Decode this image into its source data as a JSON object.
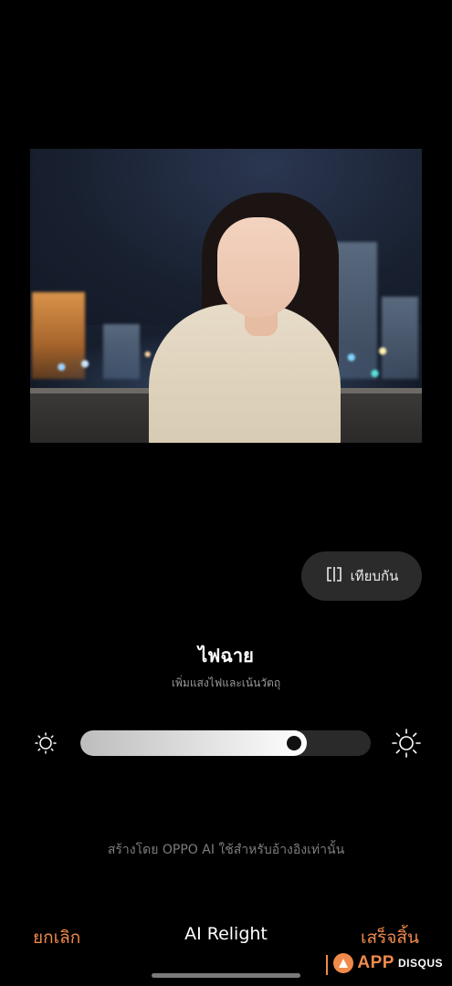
{
  "compare": {
    "label": "เทียบกัน",
    "icon": "compare-icon"
  },
  "effect": {
    "title": "ไฟฉาย",
    "subtitle": "เพิ่มแสงไฟและเน้นวัตถุ"
  },
  "slider": {
    "value_fraction": 0.78,
    "low_icon": "sun-low-icon",
    "high_icon": "sun-high-icon"
  },
  "disclaimer": "สร้างโดย OPPO AI ใช้สำหรับอ้างอิงเท่านั้น",
  "bottom_bar": {
    "cancel_label": "ยกเลิก",
    "title": "AI Relight",
    "done_label": "เสร็จสิ้น"
  },
  "watermark": {
    "app": "APP",
    "disqus": "DISQUS"
  },
  "colors": {
    "accent": "#f08a4b",
    "background": "#000000",
    "button_bg": "#2b2b2b"
  }
}
